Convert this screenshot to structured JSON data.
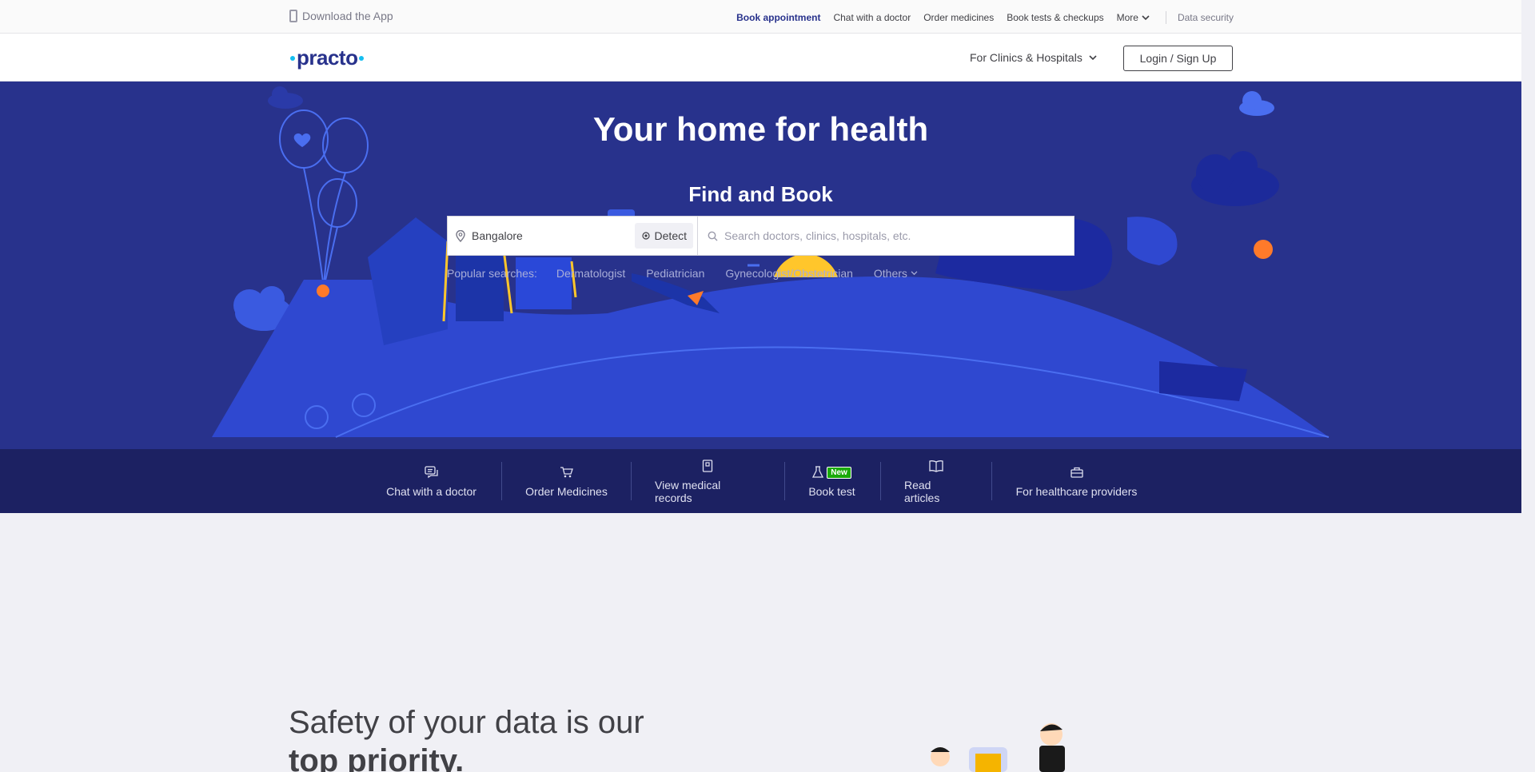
{
  "topbar": {
    "download_app": "Download the App",
    "links": {
      "book_appointment": "Book appointment",
      "chat_doctor": "Chat with a doctor",
      "order_medicines": "Order medicines",
      "book_tests": "Book tests & checkups",
      "more": "More",
      "data_security": "Data security"
    }
  },
  "header": {
    "logo": "practo",
    "clinics": "For Clinics & Hospitals",
    "login": "Login / Sign Up"
  },
  "hero": {
    "title": "Your home for health",
    "subtitle": "Find and Book",
    "location_value": "Bangalore",
    "detect": "Detect",
    "search_placeholder": "Search doctors, clinics, hospitals, etc.",
    "popular_label": "Popular searches:",
    "popular": [
      "Dermatologist",
      "Pediatrician",
      "Gynecologist/Obstetrician",
      "Others"
    ]
  },
  "quicklinks": {
    "chat": "Chat with a doctor",
    "medicines": "Order Medicines",
    "records": "View medical records",
    "test": "Book test",
    "new_badge": "New",
    "articles": "Read articles",
    "providers": "For healthcare providers"
  },
  "safety": {
    "line1": "Safety of your data is our",
    "line2": "top priority."
  },
  "colors": {
    "hero_bg": "#28328c",
    "quick_bg": "#1c2162",
    "brand_blue": "#14bef0",
    "new_green": "#1aa90a"
  }
}
